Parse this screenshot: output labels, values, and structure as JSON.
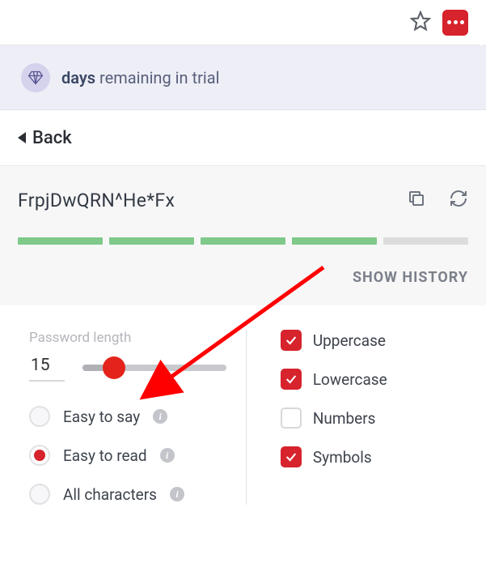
{
  "browser": {
    "star_icon": "star-icon",
    "ext_icon": "lastpass-icon"
  },
  "trial": {
    "strong": "days",
    "rest": "remaining in trial"
  },
  "back_label": "Back",
  "password": "FrpjDwQRN^He*Fx",
  "actions": {
    "copy": "copy-icon",
    "regen": "refresh-icon"
  },
  "strength": {
    "segments": 5,
    "filled": 4
  },
  "history_label": "SHOW HISTORY",
  "length": {
    "label": "Password length",
    "value": "15",
    "slider_percent": 22
  },
  "radios": [
    {
      "label": "Easy to say",
      "selected": false
    },
    {
      "label": "Easy to read",
      "selected": true
    },
    {
      "label": "All characters",
      "selected": false
    }
  ],
  "checks": [
    {
      "label": "Uppercase",
      "checked": true
    },
    {
      "label": "Lowercase",
      "checked": true
    },
    {
      "label": "Numbers",
      "checked": false
    },
    {
      "label": "Symbols",
      "checked": true
    }
  ],
  "annotation": {
    "arrow_color": "#ff0000"
  }
}
